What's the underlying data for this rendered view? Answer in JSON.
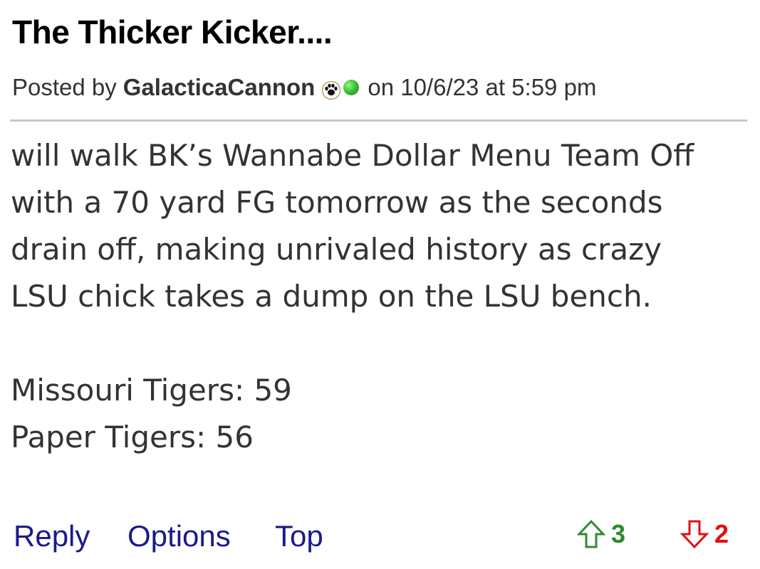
{
  "post": {
    "title": "The Thicker Kicker....",
    "meta": {
      "posted_by_label": "Posted by",
      "author": "GalacticaCannon",
      "author_badge_icon": "paw-icon",
      "online_status_icon": "online-dot-icon",
      "online_status_color": "#3cc43a",
      "date_text": "on 10/6/23 at 5:59 pm"
    },
    "body": {
      "lines": [
        "will walk BK’s Wannabe Dollar Menu Team Off",
        "with a 70 yard FG tomorrow as the seconds",
        "drain off, making unrivaled history as crazy",
        "LSU chick takes a dump on the LSU bench."
      ],
      "score_lines": [
        "Missouri Tigers: 59",
        "Paper Tigers: 56"
      ]
    },
    "actions": {
      "reply_label": "Reply",
      "options_label": "Options",
      "top_label": "Top",
      "link_color": "#1a1a8c"
    },
    "votes": {
      "up_icon": "up-arrow-icon",
      "up_count": "3",
      "up_color": "#2e8b2e",
      "down_icon": "down-arrow-icon",
      "down_count": "2",
      "down_color": "#e01010"
    }
  }
}
